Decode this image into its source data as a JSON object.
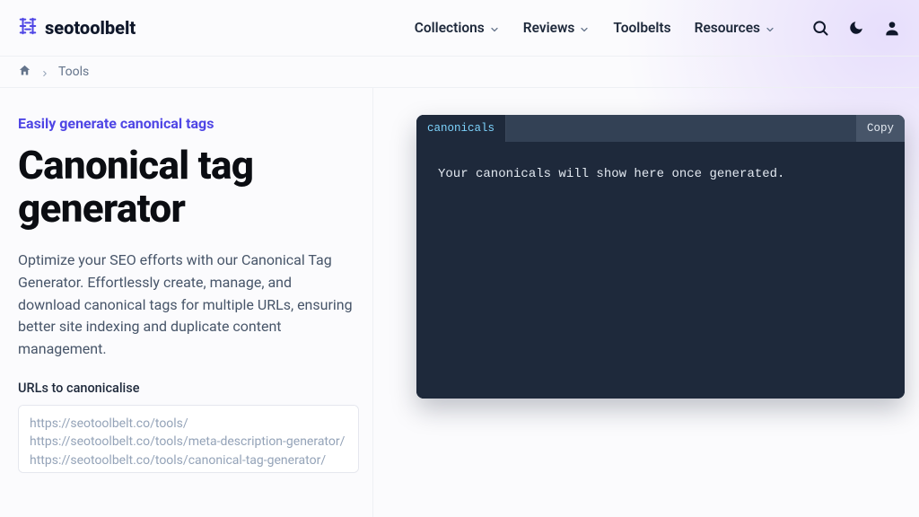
{
  "brand": {
    "name": "seotoolbelt"
  },
  "nav": {
    "items": [
      {
        "label": "Collections",
        "has_chevron": true
      },
      {
        "label": "Reviews",
        "has_chevron": true
      },
      {
        "label": "Toolbelts",
        "has_chevron": false
      },
      {
        "label": "Resources",
        "has_chevron": true
      }
    ]
  },
  "breadcrumbs": {
    "current": "Tools"
  },
  "hero": {
    "eyebrow": "Easily generate canonical tags",
    "title": "Canonical tag generator",
    "description": "Optimize your SEO efforts with our Canonical Tag Generator. Effortlessly create, manage, and download canonical tags for multiple URLs, ensuring better site indexing and duplicate content management."
  },
  "form": {
    "urls_label": "URLs to canonicalise",
    "urls_placeholder": "https://seotoolbelt.co/tools/\nhttps://seotoolbelt.co/tools/meta-description-generator/\nhttps://seotoolbelt.co/tools/canonical-tag-generator/"
  },
  "panel": {
    "tab_label": "canonicals",
    "copy_label": "Copy",
    "empty_message": "Your canonicals will show here once generated."
  }
}
